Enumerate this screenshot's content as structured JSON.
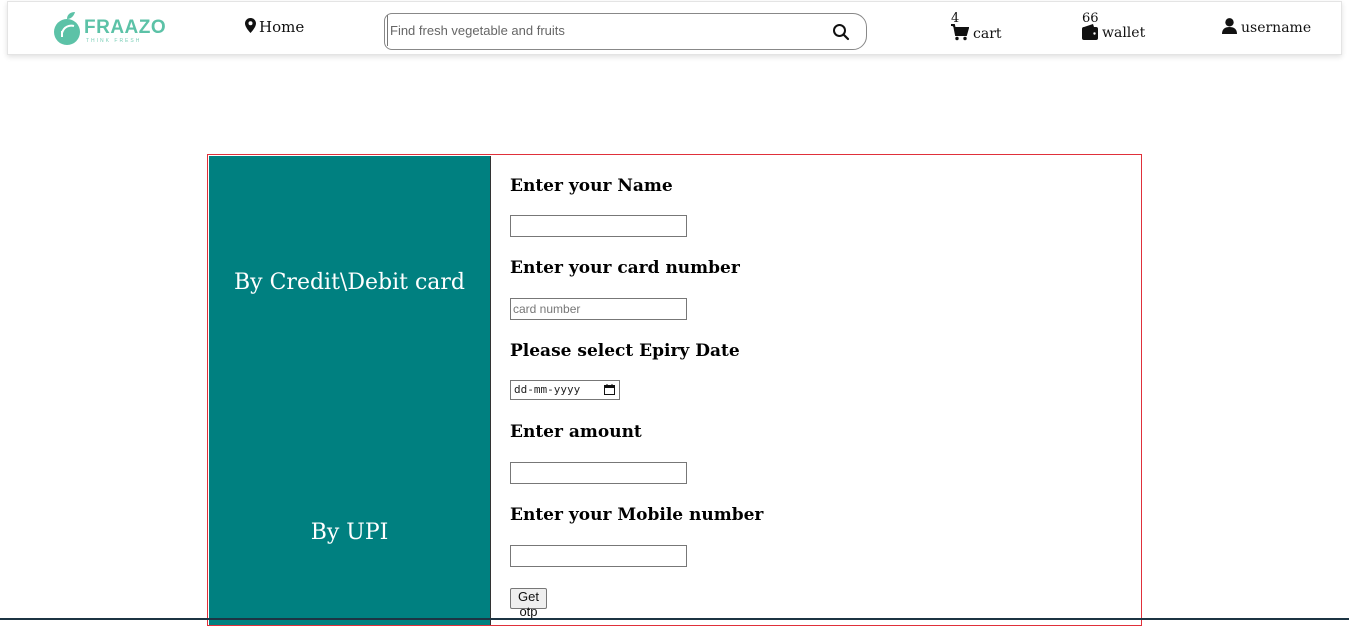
{
  "header": {
    "logo": {
      "name": "FRAAZO",
      "tagline": "THINK FRESH"
    },
    "home_label": "Home",
    "search": {
      "placeholder": "Find fresh vegetable and fruits"
    },
    "cart": {
      "count": "4",
      "label": "cart"
    },
    "wallet": {
      "count": "66",
      "label": "wallet"
    },
    "user": {
      "label": "username"
    },
    "icons": [
      "map-pin-icon",
      "search-icon",
      "cart-icon",
      "wallet-icon",
      "user-icon"
    ]
  },
  "payment": {
    "methods": [
      {
        "label": "By Credit\\Debit card"
      },
      {
        "label": "By UPI"
      }
    ],
    "form": {
      "name_label": "Enter your Name",
      "card_label": "Enter your card number",
      "card_placeholder": "card number",
      "expiry_label": "Please select Epiry Date",
      "expiry_placeholder": "dd-mm-yyyy",
      "amount_label": "Enter amount",
      "mobile_label": "Enter your Mobile number",
      "otp_button": "Get otp"
    }
  },
  "colors": {
    "brand": "#5cc2a7",
    "method_panel": "#008080",
    "panel_border": "#e0303a"
  }
}
